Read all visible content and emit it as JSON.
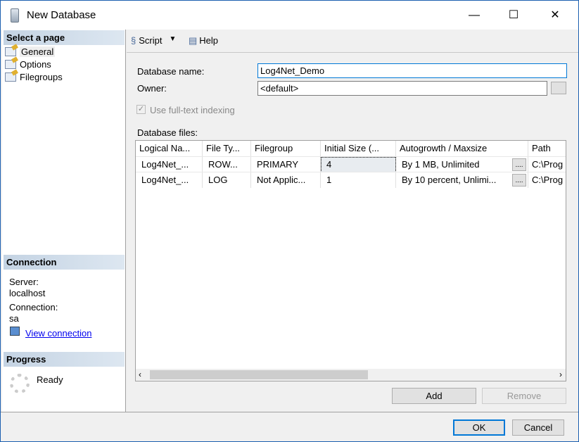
{
  "window": {
    "title": "New Database",
    "minimize": "—",
    "maximize": "☐",
    "close": "✕"
  },
  "sidebar": {
    "select_header": "Select a page",
    "items": [
      {
        "label": "General"
      },
      {
        "label": "Options"
      },
      {
        "label": "Filegroups"
      }
    ],
    "connection_header": "Connection",
    "server_label": "Server:",
    "server_value": "localhost",
    "connection_label": "Connection:",
    "connection_value": "sa",
    "view_connection": "View connection",
    "progress_header": "Progress",
    "progress_status": "Ready"
  },
  "toolbar": {
    "script": "Script",
    "help": "Help"
  },
  "form": {
    "db_name_label": "Database name:",
    "db_name_value": "Log4Net_Demo",
    "owner_label": "Owner:",
    "owner_value": "<default>",
    "fulltext_label": "Use full-text indexing",
    "fulltext_checked": true,
    "files_label": "Database files:"
  },
  "grid": {
    "columns": [
      "Logical Na...",
      "File Ty...",
      "Filegroup",
      "Initial Size (...",
      "Autogrowth / Maxsize",
      "Path"
    ],
    "rows": [
      [
        "Log4Net_...",
        "ROW...",
        "PRIMARY",
        "4",
        "By 1 MB, Unlimited",
        "C:\\Prog"
      ],
      [
        "Log4Net_...",
        "LOG",
        "Not Applic...",
        "1",
        "By 10 percent, Unlimi...",
        "C:\\Prog"
      ]
    ],
    "ellipsis": "...."
  },
  "buttons": {
    "add": "Add",
    "remove": "Remove",
    "ok": "OK",
    "cancel": "Cancel"
  }
}
